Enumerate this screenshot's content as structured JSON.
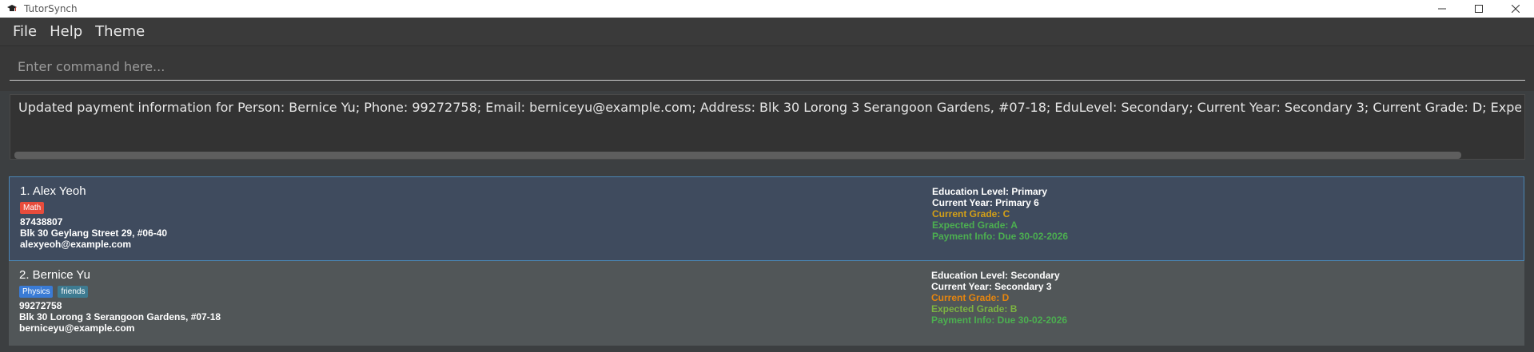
{
  "window": {
    "title": "TutorSynch"
  },
  "menu": {
    "items": [
      "File",
      "Help",
      "Theme"
    ]
  },
  "command": {
    "placeholder": "Enter command here..."
  },
  "result": {
    "text": "Updated payment information for Person: Bernice Yu; Phone: 99272758; Email: berniceyu@example.com; Address: Blk 30 Lorong 3 Serangoon Gardens, #07-18; EduLevel: Secondary; Current Year: Secondary 3; Current Grade: D; Expected Grade: B; Tags: [Physic"
  },
  "colors": {
    "grade_c": "#d4a017",
    "grade_d": "#e6850e",
    "expected_a": "#4caf50",
    "expected_b": "#7cb342",
    "payment": "#4caf50"
  },
  "persons": [
    {
      "name": "1. Alex Yeoh",
      "tags": [
        "Math"
      ],
      "phone": "87438807",
      "address": "Blk 30 Geylang Street 29, #06-40",
      "email": "alexyeoh@example.com",
      "edu_level": "Education Level: Primary",
      "current_year": "Current Year: Primary 6",
      "current_grade": "Current Grade: C",
      "expected_grade": "Expected Grade: A",
      "payment": "Payment Info: Due 30-02-2026"
    },
    {
      "name": "2. Bernice Yu",
      "tags": [
        "Physics",
        "friends"
      ],
      "phone": "99272758",
      "address": "Blk 30 Lorong 3 Serangoon Gardens, #07-18",
      "email": "berniceyu@example.com",
      "edu_level": "Education Level: Secondary",
      "current_year": "Current Year: Secondary 3",
      "current_grade": "Current Grade: D",
      "expected_grade": "Expected Grade: B",
      "payment": "Payment Info: Due 30-02-2026"
    }
  ]
}
